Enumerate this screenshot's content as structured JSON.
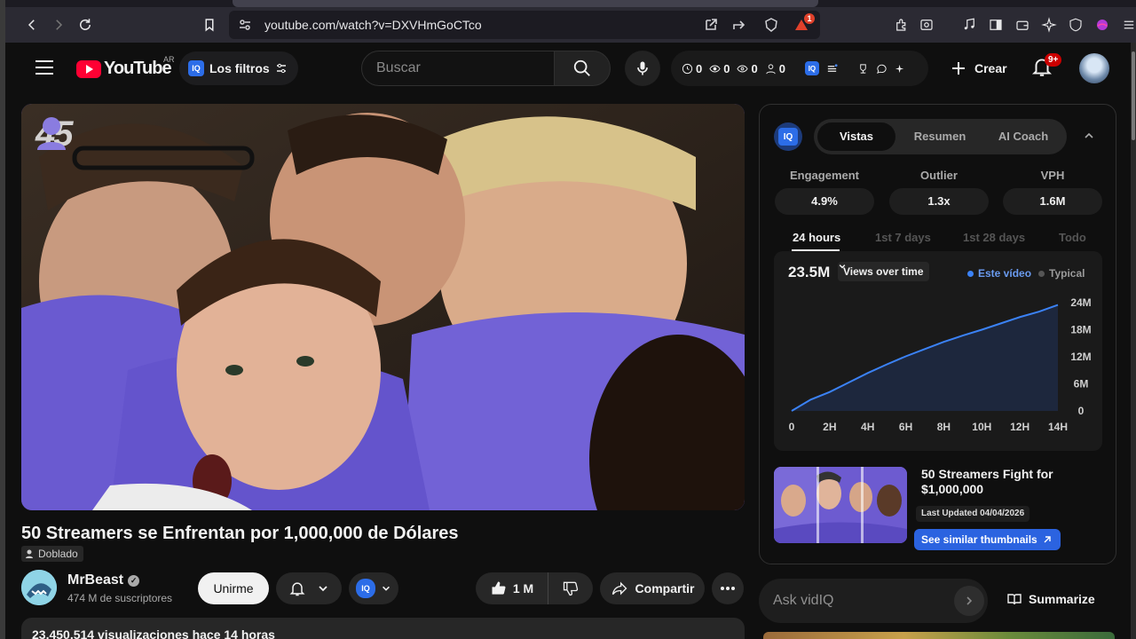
{
  "browser": {
    "url": "youtube.com/watch?v=DXVHmGoCTco",
    "notification_count": "1"
  },
  "masthead": {
    "logo_text": "YouTube",
    "country_code": "AR",
    "filters_label": "Los filtros",
    "search_placeholder": "Buscar",
    "stats": [
      "0",
      "0",
      "0",
      "0"
    ],
    "create_label": "Crear",
    "notifications_badge": "9+"
  },
  "video": {
    "overlay_number": "45",
    "title": "50 Streamers se Enfrentan por 1,000,000 de Dólares",
    "dubbed_label": "Doblado",
    "channel_name": "MrBeast",
    "subscribers": "474 M de suscriptores",
    "join_label": "Unirme",
    "likes": "1 M",
    "share_label": "Compartir",
    "views_line": "23.450.514 visualizaciones  hace 14 horas"
  },
  "panel": {
    "tabs": [
      "Vistas",
      "Resumen",
      "AI Coach"
    ],
    "active_tab": "Vistas",
    "metrics": [
      {
        "label": "Engagement",
        "value": "4.9%"
      },
      {
        "label": "Outlier",
        "value": "1.3x"
      },
      {
        "label": "VPH",
        "value": "1.6M"
      }
    ],
    "ranges": [
      "24 hours",
      "1st 7 days",
      "1st 28 days",
      "Todo"
    ],
    "active_range": "24 hours",
    "total_views": "23.5M",
    "metric_select": "Views over time",
    "legend": [
      "Este vídeo",
      "Typical"
    ],
    "related": {
      "title": "50 Streamers Fight for $1,000,000",
      "updated": "Last Updated 04/04/2026",
      "similar_label": "See similar thumbnails"
    },
    "ask_placeholder": "Ask vidIQ",
    "summarize_label": "Summarize"
  },
  "chart_data": {
    "type": "line",
    "x": [
      0,
      1,
      2,
      3,
      4,
      5,
      6,
      7,
      8,
      9,
      10,
      11,
      12,
      13,
      14
    ],
    "series": [
      {
        "name": "Este vídeo",
        "values": [
          0,
          2.5,
          4.2,
          6.3,
          8.4,
          10.3,
          12.1,
          13.7,
          15.3,
          16.7,
          18.0,
          19.4,
          20.8,
          22.0,
          23.5
        ]
      }
    ],
    "xticks": [
      "0",
      "2H",
      "4H",
      "6H",
      "8H",
      "10H",
      "12H",
      "14H"
    ],
    "yticks": [
      "24M",
      "18M",
      "12M",
      "6M",
      "0"
    ],
    "ylim": [
      0,
      24
    ],
    "xlim": [
      0,
      14
    ],
    "color": "#3b82f6"
  }
}
